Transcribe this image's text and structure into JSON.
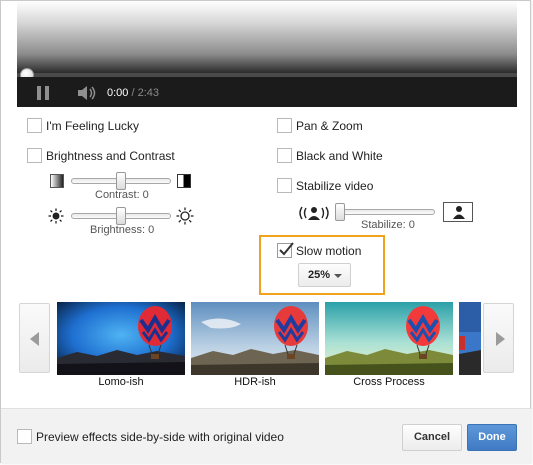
{
  "player": {
    "time_current": "0:00",
    "time_separator": " / ",
    "time_duration": "2:43",
    "progress_fraction": 0
  },
  "effects": {
    "feeling_lucky": {
      "label": "I'm Feeling Lucky",
      "checked": false
    },
    "brightness_contrast": {
      "label": "Brightness and Contrast",
      "checked": false
    },
    "contrast_caption": "Contrast: 0",
    "contrast_value": 0,
    "brightness_caption": "Brightness: 0",
    "brightness_value": 0,
    "pan_zoom": {
      "label": "Pan & Zoom",
      "checked": false
    },
    "black_white": {
      "label": "Black and White",
      "checked": false
    },
    "stabilize": {
      "label": "Stabilize video",
      "checked": false
    },
    "stabilize_caption": "Stabilize: 0",
    "stabilize_value": 0,
    "slow_motion": {
      "label": "Slow motion",
      "checked": true,
      "selected": "25%"
    }
  },
  "filters": [
    {
      "label": "Lomo-ish"
    },
    {
      "label": "HDR-ish"
    },
    {
      "label": "Cross Process"
    }
  ],
  "footer": {
    "preview_label": "Preview effects side-by-side with original video",
    "cancel_label": "Cancel",
    "done_label": "Done"
  },
  "colors": {
    "highlight_border": "#f0a21d",
    "done_button": "#4a86cf",
    "balloon_red": "#d92c33"
  },
  "icons": {
    "pause": "pause-icon",
    "volume": "volume-icon",
    "brightness_low": "sun-small-icon",
    "brightness_high": "sun-large-icon",
    "contrast_low": "contrast-low-icon",
    "contrast_high": "contrast-high-icon",
    "stabilize": "person-shaking-icon",
    "stabilize_max": "person-icon",
    "check": "checkmark-icon",
    "dropdown": "chevron-down-icon",
    "prev": "chevron-left-icon",
    "next": "chevron-right-icon"
  }
}
